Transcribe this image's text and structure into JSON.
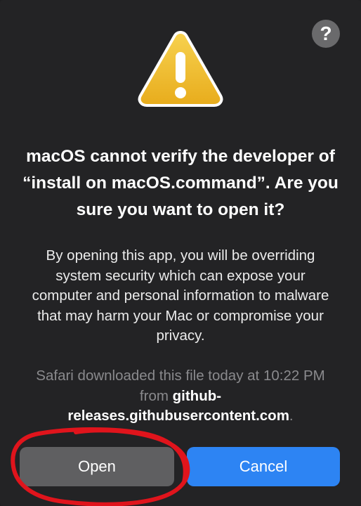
{
  "dialog": {
    "help_label": "?",
    "title": "macOS cannot verify the developer of “install on macOS.command”. Are you sure you want to open it?",
    "body": "By opening this app, you will be overriding system security which can expose your computer and personal information to malware that may harm your Mac or compromise your privacy.",
    "source_prefix": "Safari downloaded this file today at 10:22 PM from ",
    "source_host": "github-releases.githubusercontent.com",
    "source_suffix": ".",
    "open_label": "Open",
    "cancel_label": "Cancel"
  },
  "icons": {
    "warning": "warning-icon",
    "help": "help-icon"
  },
  "colors": {
    "background": "#232325",
    "primary_button": "#2d84f3",
    "secondary_button": "#5f5f61",
    "warning_fill": "#f2c030",
    "annotation": "#e0141c"
  }
}
